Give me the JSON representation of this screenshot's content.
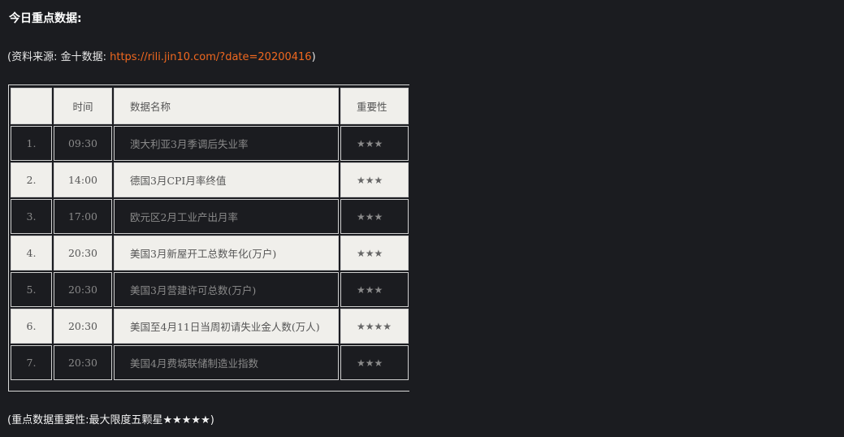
{
  "title": "今日重点数据:",
  "source": {
    "prefix": "(资料来源: 金十数据: ",
    "link": "https://rili.jin10.com/?date=20200416",
    "suffix": ")"
  },
  "table": {
    "headers": {
      "index": "",
      "time": "时间",
      "name": "数据名称",
      "importance": "重要性"
    },
    "rows": [
      {
        "index": "1.",
        "time": "09:30",
        "name": "澳大利亚3月季调后失业率",
        "importance": "★★★"
      },
      {
        "index": "2.",
        "time": "14:00",
        "name": "德国3月CPI月率终值",
        "importance": "★★★"
      },
      {
        "index": "3.",
        "time": "17:00",
        "name": "欧元区2月工业产出月率",
        "importance": "★★★"
      },
      {
        "index": "4.",
        "time": "20:30",
        "name": "美国3月新屋开工总数年化(万户)",
        "importance": "★★★"
      },
      {
        "index": "5.",
        "time": "20:30",
        "name": "美国3月营建许可总数(万户)",
        "importance": "★★★"
      },
      {
        "index": "6.",
        "time": "20:30",
        "name": "美国至4月11日当周初请失业金人数(万人)",
        "importance": "★★★★"
      },
      {
        "index": "7.",
        "time": "20:30",
        "name": "美国4月费城联储制造业指数",
        "importance": "★★★"
      }
    ]
  },
  "footnote": "(重点数据重要性:最大限度五颗星★★★★★)"
}
